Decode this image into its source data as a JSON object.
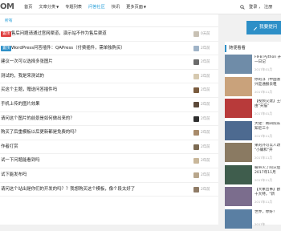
{
  "header": {
    "logo": "OM",
    "nav": [
      {
        "label": "首页",
        "active": false,
        "caret": false
      },
      {
        "label": "文章分类",
        "active": false,
        "caret": true
      },
      {
        "label": "专题列表",
        "active": false,
        "caret": false
      },
      {
        "label": "问答社区",
        "active": true,
        "caret": false
      },
      {
        "label": "快讯",
        "active": false,
        "caret": false
      },
      {
        "label": "更多页面",
        "active": false,
        "caret": true
      }
    ],
    "login": "登录",
    "register": "注册"
  },
  "tabs": [
    "",
    "所有"
  ],
  "colors": {
    "accent": "#1e9bd7",
    "button": "#2d8fc7"
  },
  "questions": [
    {
      "badge": "置顶",
      "badge_color": "#e03c3c",
      "title": "售后问题请通过官网渠道，演示站不作为售后渠道",
      "meta": "0天前"
    },
    {
      "badge": "置顶",
      "badge_color": "#2d8fc7",
      "title": "WordPress问答插件：QAPress（付费插件，需单独购买）",
      "meta": "2年前"
    },
    {
      "badge": "",
      "badge_color": "",
      "title": "建议一次可以选择多张图片",
      "meta": "2年前"
    },
    {
      "badge": "",
      "badge_color": "",
      "title": "测试的，我是来测试的",
      "meta": "2年前"
    },
    {
      "badge": "",
      "badge_color": "",
      "title": "买这个主题，赠送问答插件吗",
      "meta": "2年前"
    },
    {
      "badge": "",
      "badge_color": "",
      "title": "手机上传的图片效果",
      "meta": "2年前"
    },
    {
      "badge": "",
      "badge_color": "",
      "title": "请问这个图片的前景是如何做出来的？",
      "meta": "2年前"
    },
    {
      "badge": "",
      "badge_color": "",
      "title": "购买了后重模板以后更新都是免费的吗？",
      "meta": "2年前"
    },
    {
      "badge": "",
      "badge_color": "",
      "title": "作者打赏",
      "meta": "2年前"
    },
    {
      "badge": "",
      "badge_color": "",
      "title": "试一下问题能看到吗",
      "meta": "2年前"
    },
    {
      "badge": "",
      "badge_color": "",
      "title": "试下能发布吗",
      "meta": "2年前"
    },
    {
      "badge": "",
      "badge_color": "",
      "title": "请问这个站出是你们的开发的吗？？我想购买这个模板，像个段太好了",
      "meta": "2年前"
    }
  ],
  "sidebar": {
    "ask_button": "我要提问",
    "panel_title": "随便看看",
    "items": [
      {
        "line1": "FIFB Python 开",
        "line2": "一日记",
        "date": "2017年01月",
        "thumb": "#6f8ca8"
      },
      {
        "line1": "你的浮（中国浙",
        "line2": "兴是通报去粗",
        "date": "2017年11月",
        "thumb": "#c9a27b"
      },
      {
        "line1": "【视频交建】王者",
        "line2": "由\"天猫\"",
        "date": "2017年01月",
        "thumb": "#b83a3a"
      },
      {
        "line1": "大佬：韩四院长",
        "line2": "知近三十",
        "date": "2017年11月",
        "thumb": "#4d6a90"
      },
      {
        "line1": "果的外可以人改",
        "line2": "\"小确和\"开",
        "date": "2017年11月",
        "thumb": "#8a7a62"
      },
      {
        "line1": "被带火了的灾后",
        "line2": "2017年11月",
        "date": "2017年11月",
        "thumb": "#3f5d4d"
      },
      {
        "line1": "【大象出事】欧",
        "line2": "十大特，\"新",
        "date": "2017年11月",
        "thumb": "#7b6d8d"
      },
      {
        "line1": "世界，你好！",
        "line2": "",
        "date": "2017年",
        "thumb": "#5a7fa3"
      }
    ]
  }
}
